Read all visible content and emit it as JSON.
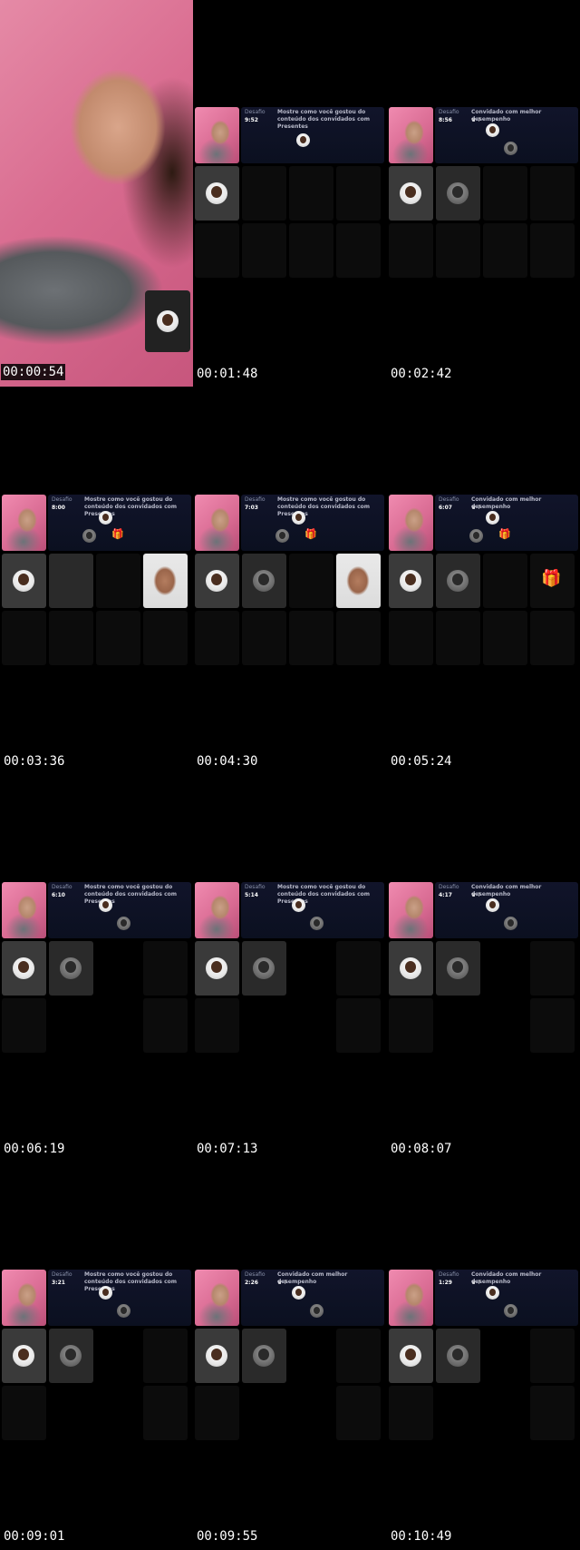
{
  "timestamps": [
    "00:00:54",
    "00:01:48",
    "00:02:42",
    "00:03:36",
    "00:04:30",
    "00:05:24",
    "00:06:19",
    "00:07:13",
    "00:08:07",
    "00:09:01",
    "00:09:55",
    "00:10:49"
  ],
  "panel": {
    "label": "Desafio",
    "msg_gifts": "Mostre como você gostou do conteúdo dos convidados com Presentes",
    "msg_best": "Convidado com melhor desempenho",
    "crown_text": "♛ ?"
  },
  "timers": [
    "9:52",
    "8:56",
    "8:00",
    "7:03",
    "6:07",
    "6:10",
    "5:14",
    "4:17",
    "3:21",
    "2:26",
    "1:29"
  ],
  "icons": {
    "avatar": "user-avatar-icon",
    "gift": "gift-icon",
    "crown": "crown-icon"
  },
  "colors": {
    "background": "#000000",
    "panel": "#11142a",
    "host_pink": "#e58aa6"
  }
}
